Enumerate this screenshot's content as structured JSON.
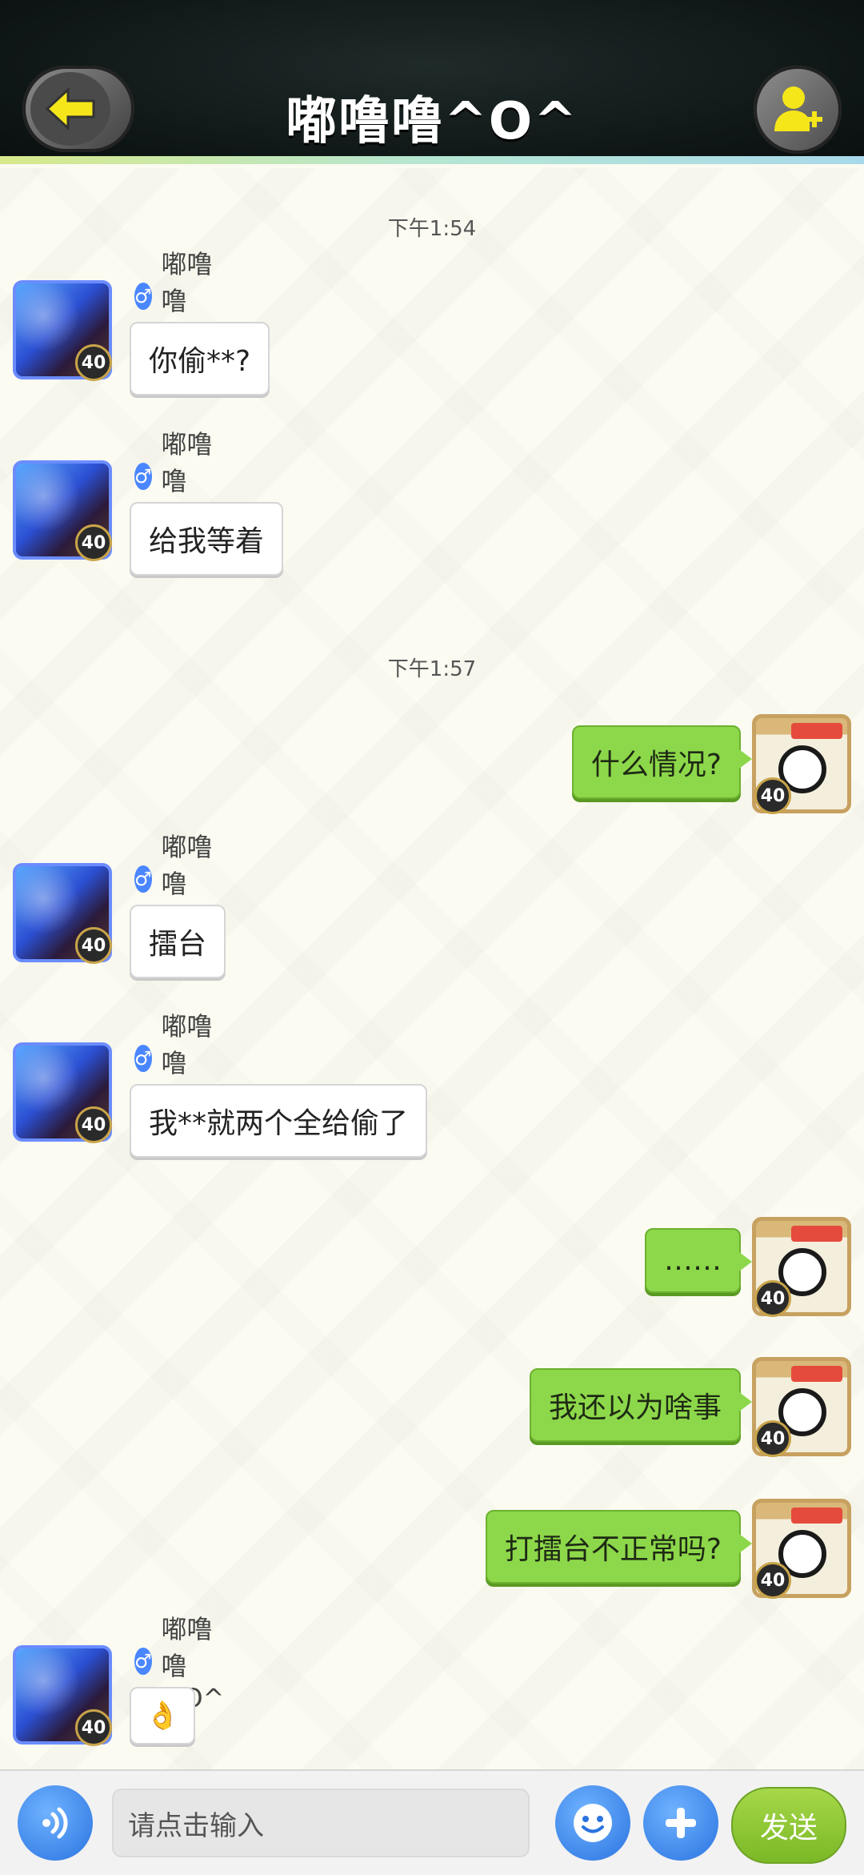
{
  "header": {
    "title": "嘟噜噜^O^",
    "back_icon": "arrow-left-icon",
    "add_friend_icon": "add-friend-icon",
    "accent_color": "#f5e61a"
  },
  "chat": {
    "timestamps": [
      "下午1:54",
      "下午1:57"
    ],
    "friend_name": "嘟噜噜^O^",
    "avatar_level": "40",
    "messages": [
      {
        "side": "left",
        "text": "你偷**?"
      },
      {
        "side": "left",
        "text": "给我等着"
      },
      {
        "side": "right",
        "text": "什么情况?"
      },
      {
        "side": "left",
        "text": "擂台"
      },
      {
        "side": "left",
        "text": "我**就两个全给偷了"
      },
      {
        "side": "right",
        "text": "……"
      },
      {
        "side": "right",
        "text": "我还以为啥事"
      },
      {
        "side": "right",
        "text": "打擂台不正常吗?"
      },
      {
        "side": "left",
        "text": "👌"
      }
    ]
  },
  "input": {
    "placeholder": "请点击输入",
    "send_label": "发送",
    "voice_icon": "voice-icon",
    "emoji_icon": "emoji-icon",
    "plus_icon": "plus-icon"
  }
}
